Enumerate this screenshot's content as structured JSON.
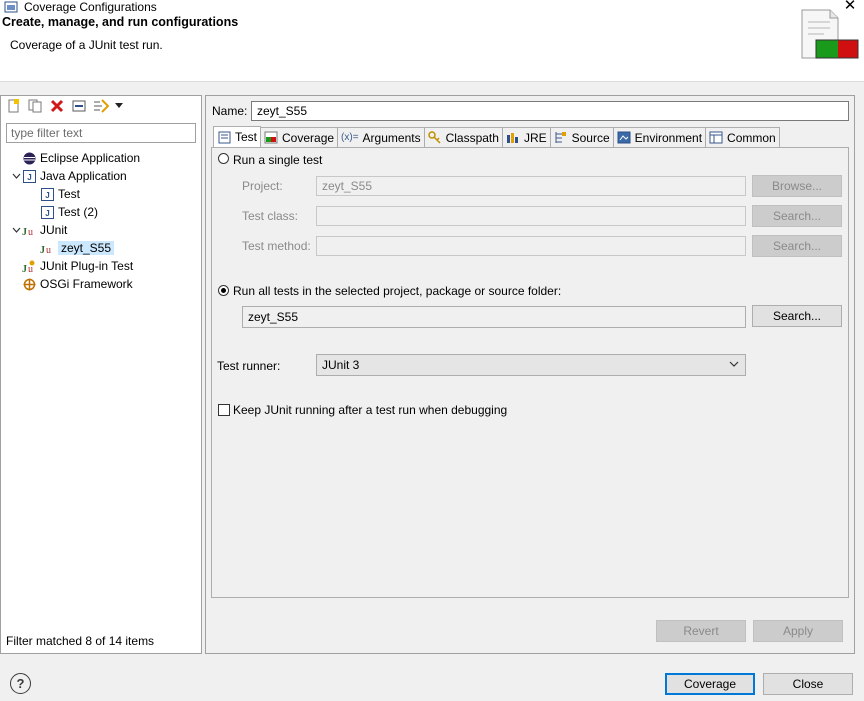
{
  "window": {
    "title": "Coverage Configurations",
    "close_glyph": "✕"
  },
  "header": {
    "title": "Create, manage, and run configurations",
    "subtitle": "Coverage of a JUnit test run."
  },
  "left": {
    "toolbar": [
      "new-config-icon",
      "duplicate-icon",
      "delete-icon",
      "collapse-all-icon",
      "filter-icon",
      "dropdown-arrow-icon"
    ],
    "filter_placeholder": "type filter text",
    "tree": [
      {
        "label": "Eclipse Application",
        "icon": "eclipse-icon",
        "level": 0
      },
      {
        "label": "Java Application",
        "icon": "java-app-icon",
        "level": 0,
        "expanded": true
      },
      {
        "label": "Test",
        "icon": "java-app-icon",
        "level": 1
      },
      {
        "label": "Test (2)",
        "icon": "java-app-icon",
        "level": 1
      },
      {
        "label": "JUnit",
        "icon": "junit-icon",
        "level": 0,
        "expanded": true
      },
      {
        "label": "zeyt_S55",
        "icon": "junit-icon",
        "level": 1,
        "selected": true
      },
      {
        "label": "JUnit Plug-in Test",
        "icon": "junit-plugin-icon",
        "level": 0
      },
      {
        "label": "OSGi Framework",
        "icon": "osgi-icon",
        "level": 0
      }
    ],
    "status": "Filter matched 8 of 14 items"
  },
  "main": {
    "name_label": "Name:",
    "name_value": "zeyt_S55",
    "tabs": [
      {
        "label": "Test",
        "icon": "test-tab-icon",
        "active": true
      },
      {
        "label": "Coverage",
        "icon": "coverage-tab-icon"
      },
      {
        "label": "Arguments",
        "icon": "arguments-tab-icon",
        "icon_glyph": "(x)="
      },
      {
        "label": "Classpath",
        "icon": "classpath-tab-icon"
      },
      {
        "label": "JRE",
        "icon": "jre-tab-icon"
      },
      {
        "label": "Source",
        "icon": "source-tab-icon"
      },
      {
        "label": "Environment",
        "icon": "environment-tab-icon"
      },
      {
        "label": "Common",
        "icon": "common-tab-icon"
      }
    ],
    "single_test": {
      "radio_label": "Run a single test",
      "project_label": "Project:",
      "project_value": "zeyt_S55",
      "browse_label": "Browse...",
      "class_label": "Test class:",
      "class_value": "",
      "class_search_label": "Search...",
      "method_label": "Test method:",
      "method_value": "",
      "method_search_label": "Search..."
    },
    "all_tests": {
      "radio_label": "Run all tests in the selected project, package or source folder:",
      "value": "zeyt_S55",
      "search_label": "Search..."
    },
    "runner": {
      "label": "Test runner:",
      "value": "JUnit 3"
    },
    "keep_running": {
      "label": "Keep JUnit running after a test run when debugging",
      "checked": false
    },
    "revert_label": "Revert",
    "apply_label": "Apply"
  },
  "footer": {
    "help_glyph": "?",
    "coverage_label": "Coverage",
    "close_label": "Close"
  }
}
